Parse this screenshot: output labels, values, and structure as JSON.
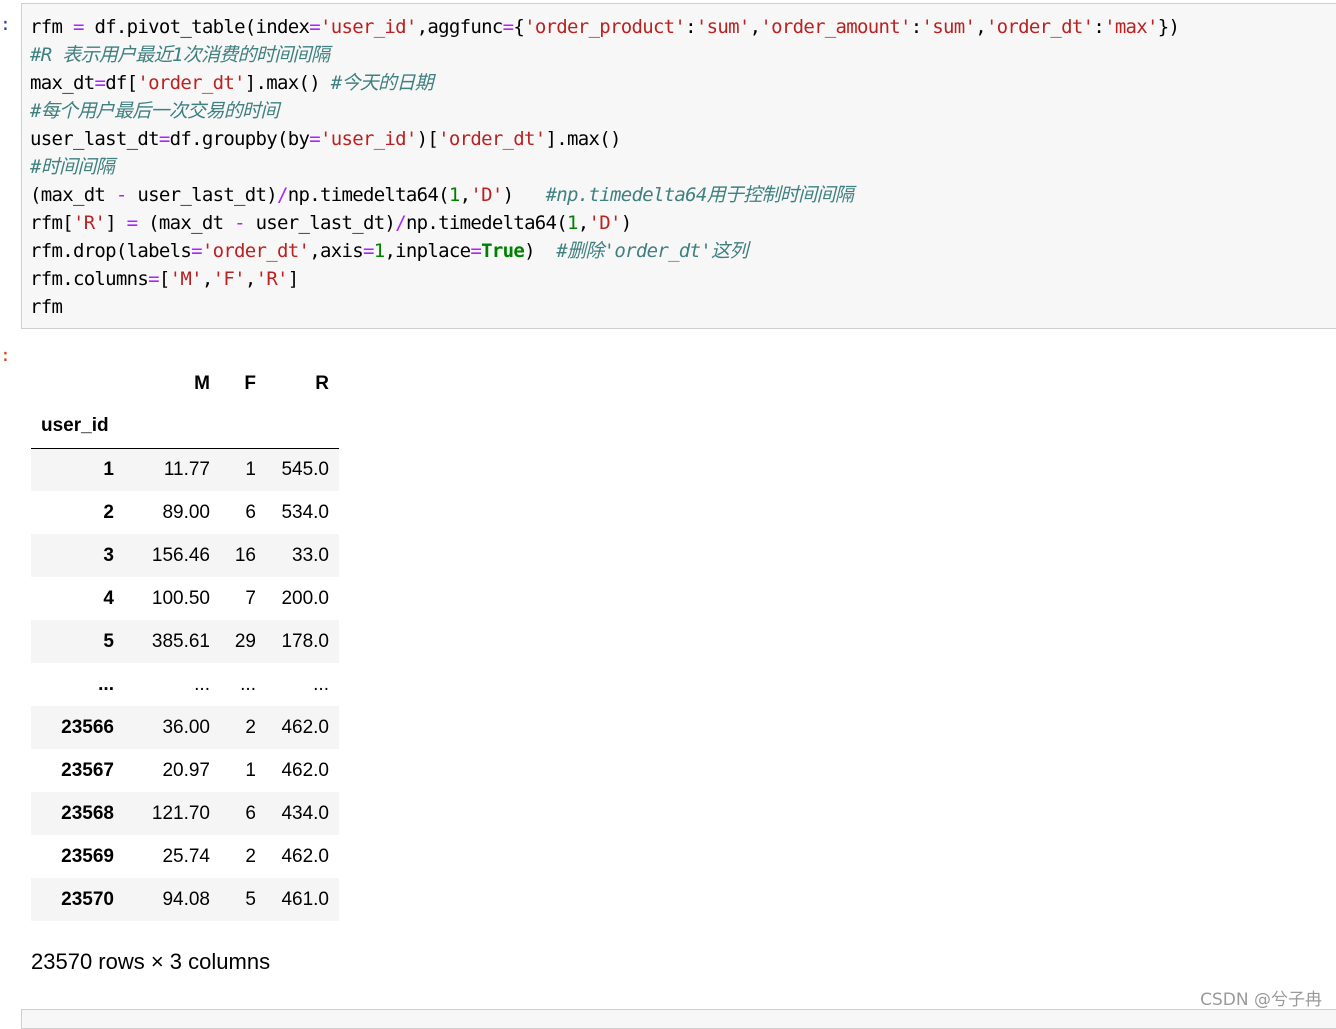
{
  "prompts": {
    "in": ":",
    "out": ":"
  },
  "code_lines": [
    [
      [
        "n",
        "rfm "
      ],
      [
        "op",
        "="
      ],
      [
        "n",
        " df.pivot_table(index"
      ],
      [
        "op",
        "="
      ],
      [
        "str",
        "'user_id'"
      ],
      [
        "n",
        ",aggfunc"
      ],
      [
        "op",
        "="
      ],
      [
        "n",
        "{"
      ],
      [
        "str",
        "'order_product'"
      ],
      [
        "n",
        ":"
      ],
      [
        "str",
        "'sum'"
      ],
      [
        "n",
        ","
      ],
      [
        "str",
        "'order_amount'"
      ],
      [
        "n",
        ":"
      ],
      [
        "str",
        "'sum'"
      ],
      [
        "n",
        ","
      ],
      [
        "str",
        "'order_dt'"
      ],
      [
        "n",
        ":"
      ],
      [
        "str",
        "'max'"
      ],
      [
        "n",
        "})"
      ]
    ],
    [
      [
        "com",
        "#R 表示用户最近1次消费的时间间隔"
      ]
    ],
    [
      [
        "n",
        "max_dt"
      ],
      [
        "op",
        "="
      ],
      [
        "n",
        "df["
      ],
      [
        "str",
        "'order_dt'"
      ],
      [
        "n",
        "].max() "
      ],
      [
        "com",
        "#今天的日期"
      ]
    ],
    [
      [
        "com",
        "#每个用户最后一次交易的时间"
      ]
    ],
    [
      [
        "n",
        "user_last_dt"
      ],
      [
        "op",
        "="
      ],
      [
        "n",
        "df.groupby(by"
      ],
      [
        "op",
        "="
      ],
      [
        "str",
        "'user_id'"
      ],
      [
        "n",
        ")["
      ],
      [
        "str",
        "'order_dt'"
      ],
      [
        "n",
        "].max()"
      ]
    ],
    [
      [
        "com",
        "#时间间隔"
      ]
    ],
    [
      [
        "n",
        "(max_dt "
      ],
      [
        "op",
        "-"
      ],
      [
        "n",
        " user_last_dt)"
      ],
      [
        "op",
        "/"
      ],
      [
        "n",
        "np.timedelta64("
      ],
      [
        "num",
        "1"
      ],
      [
        "n",
        ","
      ],
      [
        "str",
        "'D'"
      ],
      [
        "n",
        ")   "
      ],
      [
        "com",
        "#np.timedelta64用于控制时间间隔"
      ]
    ],
    [
      [
        "n",
        "rfm["
      ],
      [
        "str",
        "'R'"
      ],
      [
        "n",
        "] "
      ],
      [
        "op",
        "="
      ],
      [
        "n",
        " (max_dt "
      ],
      [
        "op",
        "-"
      ],
      [
        "n",
        " user_last_dt)"
      ],
      [
        "op",
        "/"
      ],
      [
        "n",
        "np.timedelta64("
      ],
      [
        "num",
        "1"
      ],
      [
        "n",
        ","
      ],
      [
        "str",
        "'D'"
      ],
      [
        "n",
        ")"
      ]
    ],
    [
      [
        "n",
        "rfm.drop(labels"
      ],
      [
        "op",
        "="
      ],
      [
        "str",
        "'order_dt'"
      ],
      [
        "n",
        ",axis"
      ],
      [
        "op",
        "="
      ],
      [
        "num",
        "1"
      ],
      [
        "n",
        ",inplace"
      ],
      [
        "op",
        "="
      ],
      [
        "kw",
        "True"
      ],
      [
        "n",
        ")  "
      ],
      [
        "com",
        "#删除'order_dt'这列"
      ]
    ],
    [
      [
        "n",
        "rfm.columns"
      ],
      [
        "op",
        "="
      ],
      [
        "n",
        "["
      ],
      [
        "str",
        "'M'"
      ],
      [
        "n",
        ","
      ],
      [
        "str",
        "'F'"
      ],
      [
        "n",
        ","
      ],
      [
        "str",
        "'R'"
      ],
      [
        "n",
        "]"
      ]
    ],
    [
      [
        "n",
        "rfm"
      ]
    ]
  ],
  "table": {
    "columns": [
      "M",
      "F",
      "R"
    ],
    "index_name": "user_id",
    "rows": [
      {
        "idx": "1",
        "M": "11.77",
        "F": "1",
        "R": "545.0"
      },
      {
        "idx": "2",
        "M": "89.00",
        "F": "6",
        "R": "534.0"
      },
      {
        "idx": "3",
        "M": "156.46",
        "F": "16",
        "R": "33.0"
      },
      {
        "idx": "4",
        "M": "100.50",
        "F": "7",
        "R": "200.0"
      },
      {
        "idx": "5",
        "M": "385.61",
        "F": "29",
        "R": "178.0"
      },
      {
        "idx": "...",
        "M": "...",
        "F": "...",
        "R": "..."
      },
      {
        "idx": "23566",
        "M": "36.00",
        "F": "2",
        "R": "462.0"
      },
      {
        "idx": "23567",
        "M": "20.97",
        "F": "1",
        "R": "462.0"
      },
      {
        "idx": "23568",
        "M": "121.70",
        "F": "6",
        "R": "434.0"
      },
      {
        "idx": "23569",
        "M": "25.74",
        "F": "2",
        "R": "462.0"
      },
      {
        "idx": "23570",
        "M": "94.08",
        "F": "5",
        "R": "461.0"
      }
    ]
  },
  "shape_text": "23570 rows × 3 columns",
  "watermark": "CSDN @兮子冉"
}
